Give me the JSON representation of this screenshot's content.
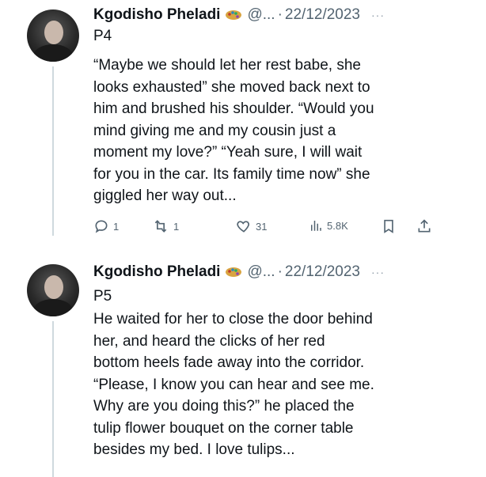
{
  "tweets": [
    {
      "author": "Kgodisho Pheladi",
      "handle": "@...",
      "separator": "·",
      "date": "22/12/2023",
      "more": "···",
      "part": "P4",
      "lines": [
        "“Maybe we should let her rest babe, she",
        "looks exhausted” she moved back next to",
        "him and brushed his shoulder. “Would you",
        "mind giving me and my cousin just a",
        "moment my love?” “Yeah sure, I will wait",
        "for you in the car. Its family time now” she",
        "giggled her way out..."
      ],
      "actions": {
        "replies": "1",
        "reposts": "1",
        "likes": "31",
        "views": "5.8K"
      }
    },
    {
      "author": "Kgodisho Pheladi",
      "handle": "@...",
      "separator": "·",
      "date": "22/12/2023",
      "more": "···",
      "part": "P5",
      "lines": [
        "He waited for her to close the door behind",
        "her, and heard the clicks of her red",
        "bottom heels fade away into the corridor.",
        "“Please, I know you can hear and see me.",
        "Why are you doing this?” he placed the",
        "tulip flower bouquet on the corner table",
        "besides my bed. I love tulips..."
      ]
    }
  ],
  "icons": {
    "reply": "reply-icon",
    "repost": "repost-icon",
    "like": "heart-icon",
    "views": "views-icon",
    "bookmark": "bookmark-icon",
    "share": "share-icon",
    "badge": "palette-emoji-icon"
  },
  "colors": {
    "text": "#0f1419",
    "secondary": "#536471",
    "thread_line": "#cfd9de"
  }
}
